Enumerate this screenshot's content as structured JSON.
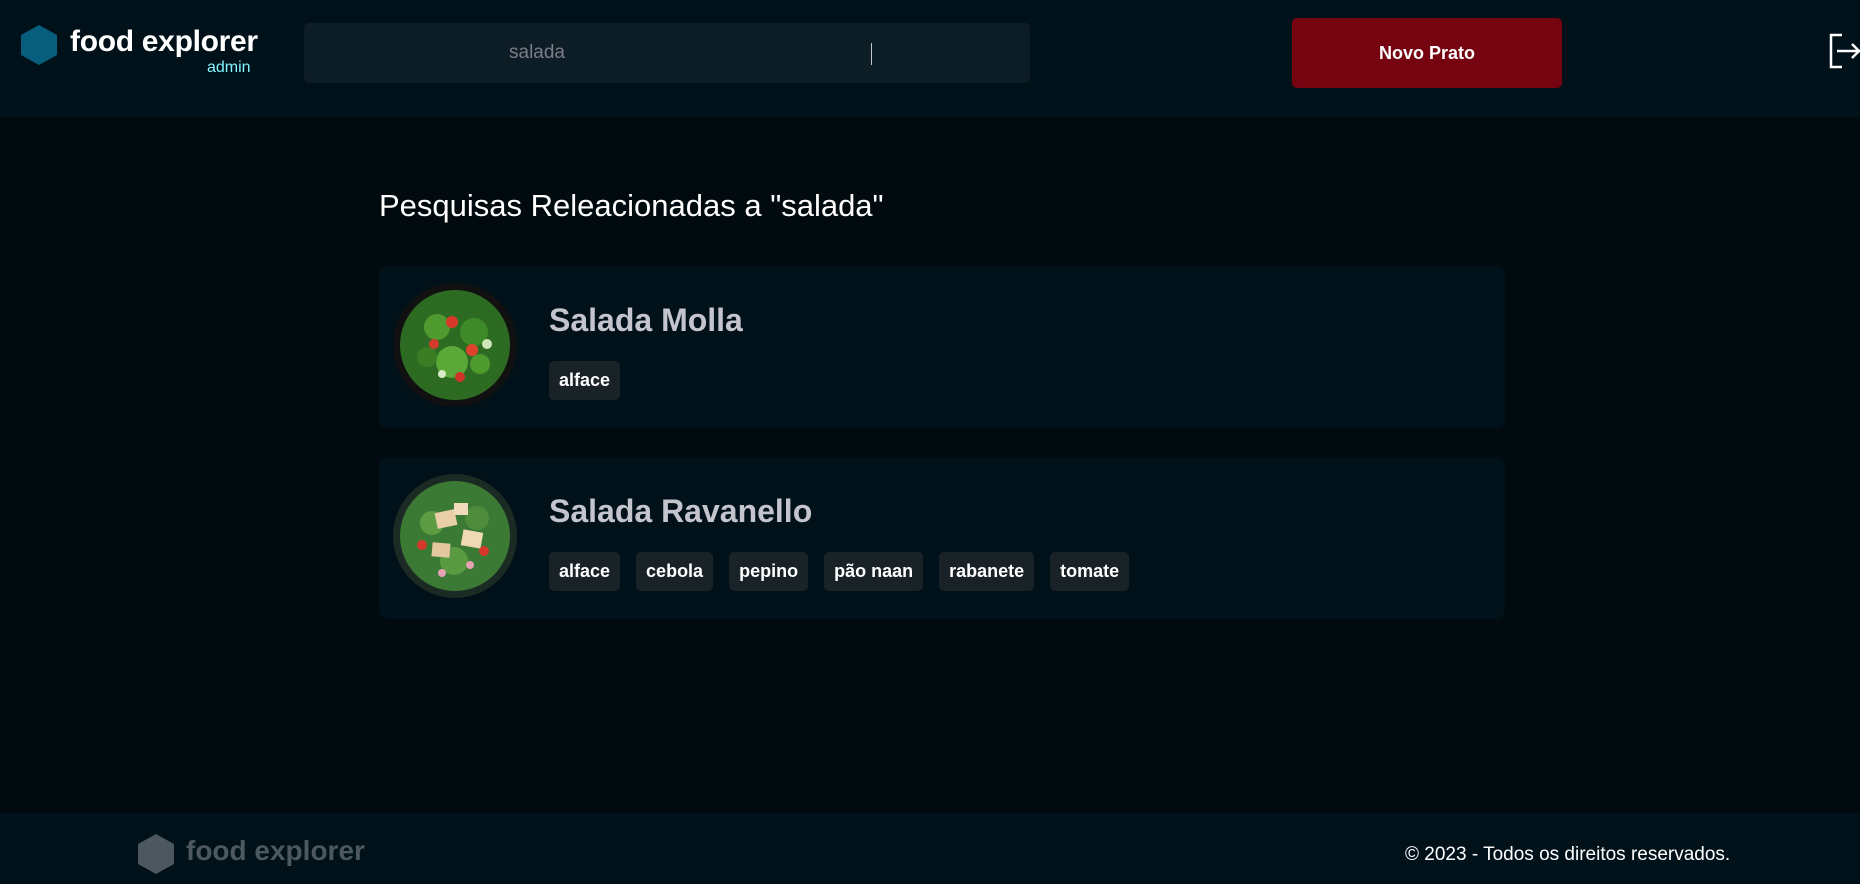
{
  "header": {
    "brand_title": "food explorer",
    "brand_role": "admin",
    "search_value": "salada",
    "new_dish_label": "Novo Prato",
    "logout_icon": "sign-out-icon"
  },
  "main": {
    "section_title": "Pesquisas Releacionadas a \"salada\"",
    "results": [
      {
        "name": "Salada Molla",
        "tags": [
          "alface"
        ]
      },
      {
        "name": "Salada Ravanello",
        "tags": [
          "alface",
          "cebola",
          "pepino",
          "pão naan",
          "rabanete",
          "tomate"
        ]
      }
    ]
  },
  "footer": {
    "brand_title": "food explorer",
    "copyright": "© 2023 - Todos os direitos reservados."
  },
  "colors": {
    "background": "#000a0f",
    "panel": "#00111a",
    "accent_red": "#750310",
    "brand_hex": "#065e7c",
    "role_text": "#82f3ff"
  }
}
